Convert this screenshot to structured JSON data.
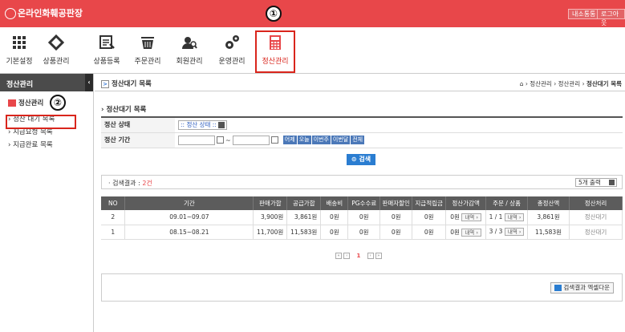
{
  "header": {
    "logo": "온라인화훼공판장",
    "btn_mypage": "내소통통",
    "btn_logout": "로그아웃"
  },
  "markers": {
    "m1": "①",
    "m2": "②"
  },
  "nav": [
    {
      "label": "기본설정",
      "icon": "grid-icon"
    },
    {
      "label": "상품관리",
      "icon": "diamond-icon"
    },
    {
      "label": "상품등록",
      "icon": "register-icon"
    },
    {
      "label": "주문관리",
      "icon": "basket-icon"
    },
    {
      "label": "회원관리",
      "icon": "users-icon"
    },
    {
      "label": "운영관리",
      "icon": "gears-icon"
    },
    {
      "label": "정산관리",
      "icon": "calculator-icon"
    }
  ],
  "sidebar": {
    "title": "정산관리",
    "section": "정산관리",
    "items": [
      "› 정산 대기 목록",
      "› 지급요청 목록",
      "› 지급완료 목록"
    ]
  },
  "breadcrumb": {
    "title": "정산대기 목록",
    "path": "⌂ › 정산관리 › 정산관리 ›",
    "current": "정산대기 목록"
  },
  "search": {
    "section_title": "› 정산대기 목록",
    "status_label": "정산 상태",
    "status_value": ":: 정산 상태 ::",
    "period_label": "정산 기간",
    "tilde": "~",
    "quick": [
      "어제",
      "오늘",
      "이번주",
      "이번달",
      "전체"
    ],
    "search_button": "⊙ 검색"
  },
  "result": {
    "prefix": "· 검색결과 : ",
    "count": "2건",
    "per_page": "5개 출력"
  },
  "table": {
    "headers": [
      "NO",
      "기간",
      "판매가합",
      "공급가합",
      "배송비",
      "PG수수료",
      "판매자할인",
      "지급적립금",
      "정산가감액",
      "주문 / 상품",
      "총정산액",
      "정산처리"
    ],
    "rows": [
      {
        "no": "2",
        "period": "09.01~09.07",
        "sale": "3,900원",
        "supply": "3,861원",
        "ship": "0원",
        "pg": "0원",
        "disc": "0원",
        "point": "0원",
        "adj": "0원",
        "adj_btn": "내역 ›",
        "orders": "1 / 1",
        "orders_btn": "내역 ›",
        "total": "3,861원",
        "status": "정산대기"
      },
      {
        "no": "1",
        "period": "08.15~08.21",
        "sale": "11,700원",
        "supply": "11,583원",
        "ship": "0원",
        "pg": "0원",
        "disc": "0원",
        "point": "0원",
        "adj": "0원",
        "adj_btn": "내역 ›",
        "orders": "3 / 3",
        "orders_btn": "내역 ›",
        "total": "11,583원",
        "status": "정산대기"
      }
    ]
  },
  "pager": {
    "first": "«",
    "prev": "‹",
    "page": "1",
    "next": "›",
    "last": "»"
  },
  "excel_button": "검색결과 엑셀다운"
}
